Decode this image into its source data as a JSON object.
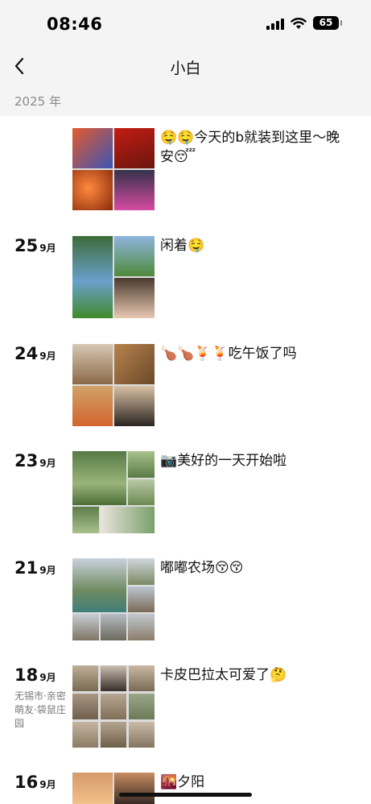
{
  "status_bar": {
    "time": "08:46",
    "battery": "65"
  },
  "nav": {
    "back_icon": "chevron-left-icon",
    "title": "小白"
  },
  "year": "2025 年",
  "posts": [
    {
      "day": "",
      "month": "",
      "location": "",
      "caption": "🤤🤤今天的b就装到这里～晚安😴",
      "photo_count": 4
    },
    {
      "day": "25",
      "month": "9月",
      "location": "",
      "caption": "闲着🤤",
      "photo_count": 3
    },
    {
      "day": "24",
      "month": "9月",
      "location": "",
      "caption": "🍗🍗🍹🍹吃午饭了吗",
      "photo_count": 4
    },
    {
      "day": "23",
      "month": "9月",
      "location": "",
      "caption": "📷美好的一天开始啦",
      "photo_count": 5
    },
    {
      "day": "21",
      "month": "9月",
      "location": "",
      "caption": "嘟嘟农场😚😚",
      "photo_count": 6
    },
    {
      "day": "18",
      "month": "9月",
      "location": "无锡市·亲密萌友·袋鼠庄园",
      "caption": "卡皮巴拉太可爱了🤔",
      "photo_count": 9
    },
    {
      "day": "16",
      "month": "9月",
      "location": "",
      "caption": "🌇夕阳",
      "photo_count": 2
    }
  ]
}
